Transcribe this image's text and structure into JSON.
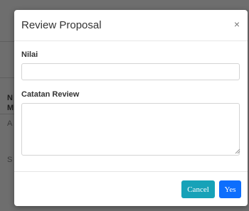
{
  "background": {
    "fragments": [
      "N",
      "M",
      "A",
      "S"
    ]
  },
  "modal": {
    "title": "Review Proposal",
    "close_glyph": "×",
    "fields": [
      {
        "label": "Nilai",
        "value": "",
        "placeholder": ""
      },
      {
        "label": "Catatan Review",
        "value": "",
        "placeholder": ""
      }
    ],
    "buttons": {
      "cancel_label": "Cancel",
      "yes_label": "Yes"
    }
  },
  "colors": {
    "cancel": "#17a2b8",
    "yes": "#0d6efd",
    "backdrop": "#6b6b6b"
  }
}
